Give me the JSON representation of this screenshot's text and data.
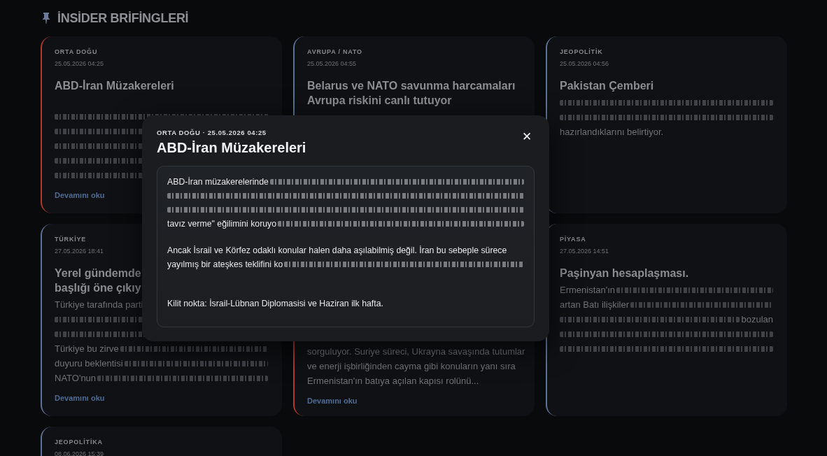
{
  "header": {
    "title": "İNSİDER BRİFİNGLERİ"
  },
  "cards": [
    {
      "category": "ORTA DOĞU",
      "date": "25.05.2026 04:25",
      "title": [
        "ABD-İran Müzakereleri"
      ],
      "color": "#b3392f",
      "body": [
        {
          "smudge": true
        },
        {
          "smudge": true
        },
        {
          "smudge": true
        },
        {
          "smudge": true
        },
        {
          "smudge": true
        }
      ],
      "link": "Devamını oku"
    },
    {
      "category": "AVRUPA / NATO",
      "date": "25.05.2026 04:55",
      "title": [
        "Belarus ve NATO savunma harcamaları",
        "Avrupa riskini canlı tutuyor"
      ],
      "color": "#5d7394"
    },
    {
      "category": "JEOPOLİTİK",
      "date": "25.05.2026 04:56",
      "title": [
        "Pakistan Çemberi"
      ],
      "color": "#5d7394",
      "body": [
        {
          "smudge": true
        },
        {
          "smudge": true
        },
        {
          "text": "hazırlandıklarını belirtiyor."
        }
      ]
    },
    {
      "category": "TÜRKİYE",
      "date": "27.05.2026 18:41",
      "title": [
        "Yerel gündemde",
        "başlığı öne çıkıy"
      ],
      "color": "#5d7394",
      "body": [
        {
          "text": "Türkiye tarafında parti"
        },
        {
          "smudge": true
        },
        {
          "smudge": true
        },
        {
          "text": "Türkiye bu zirve",
          "smudge": true
        },
        {
          "text": "duyuru beklentisi",
          "smudge": true
        },
        {
          "text": "NATO'nun",
          "smudge": true
        }
      ],
      "link": "Devamını oku"
    },
    {
      "color": "#b3392f",
      "body": [
        {
          "text": "sorguluyor. Suriye süreci, Ukrayna savaşında tutumlar"
        },
        {
          "text": "ve enerji işbirliğinden cayma gibi konuların yanı sıra"
        },
        {
          "text": "Ermenistan'ın batıya açılan kapısı rolünü..."
        }
      ],
      "link": "Devamını oku"
    },
    {
      "category": "PİYASA",
      "date": "27.05.2026 14:51",
      "title": [
        "Paşinyan hesaplaşması."
      ],
      "color": "#5d7394",
      "body": [
        {
          "text": "Ermenistan'ın",
          "smudge": true
        },
        {
          "text": "artan Batı ilişkiler",
          "smudge": true
        },
        {
          "smudge": true,
          "after": "bozulan"
        },
        {
          "smudge": true
        },
        {
          "smudge": true
        }
      ]
    },
    {
      "category": "JEOPOLİTİKA",
      "date": "08.06.2026 15:39",
      "color": "#5d7394"
    }
  ],
  "modal": {
    "meta": "ORTA DOĞU · 25.05.2026 04:25",
    "title": "ABD-İran Müzakereleri",
    "close": "✕",
    "paragraphs": [
      [
        {
          "text": "ABD-İran müzakerelerinde",
          "smudge": true
        },
        {
          "smudge": true
        },
        {
          "smudge": true
        },
        {
          "text": "tavız verme\" eğilimini koruyo",
          "smudge": true
        }
      ],
      [
        {
          "text": "Ancak İsrail ve Körfez odaklı konular halen daha aşılabilmiş değil. İran bu sebeple sürece"
        },
        {
          "text": "yayılmış bir ateşkes teklifini ko",
          "smudge": true
        }
      ],
      [
        {
          "text": "Kilit nokta: İsrail-Lübnan Diplomasisi ve Haziran ilk hafta."
        }
      ]
    ]
  }
}
